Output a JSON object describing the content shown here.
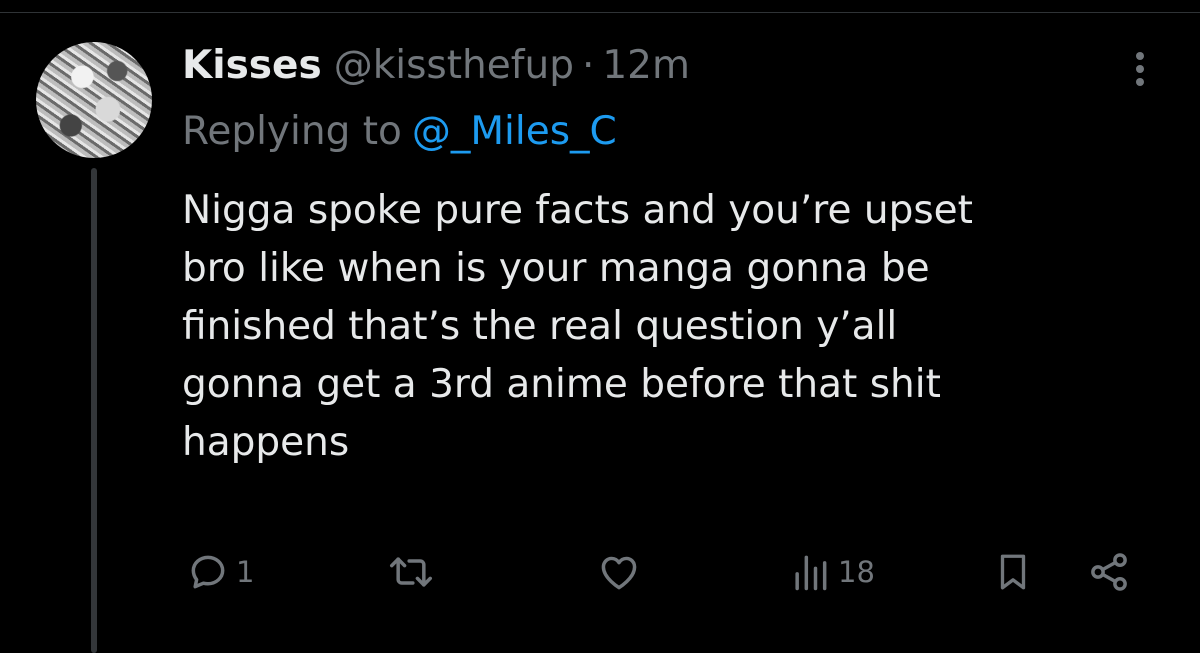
{
  "tweet": {
    "author_name": "Kisses",
    "handle": "@kissthefup",
    "separator": "·",
    "time": "12m",
    "reply_label": "Replying to",
    "reply_target": "@_Miles_C",
    "text_lines": [
      "Nigga spoke pure facts and you’re upset",
      "bro like when is your manga gonna be",
      "finished that’s the real question y’all",
      "gonna get a 3rd anime before that shit",
      "happens"
    ]
  },
  "actions": {
    "reply_count": "1",
    "views_count": "18",
    "icons": [
      "reply-icon",
      "retweet-icon",
      "like-icon",
      "views-icon",
      "bookmark-icon",
      "share-icon",
      "more-icon"
    ]
  },
  "colors": {
    "background": "#000000",
    "text": "#e7e9ea",
    "secondary": "#71767b",
    "link": "#1d9bf0",
    "thread_line": "#333639"
  }
}
